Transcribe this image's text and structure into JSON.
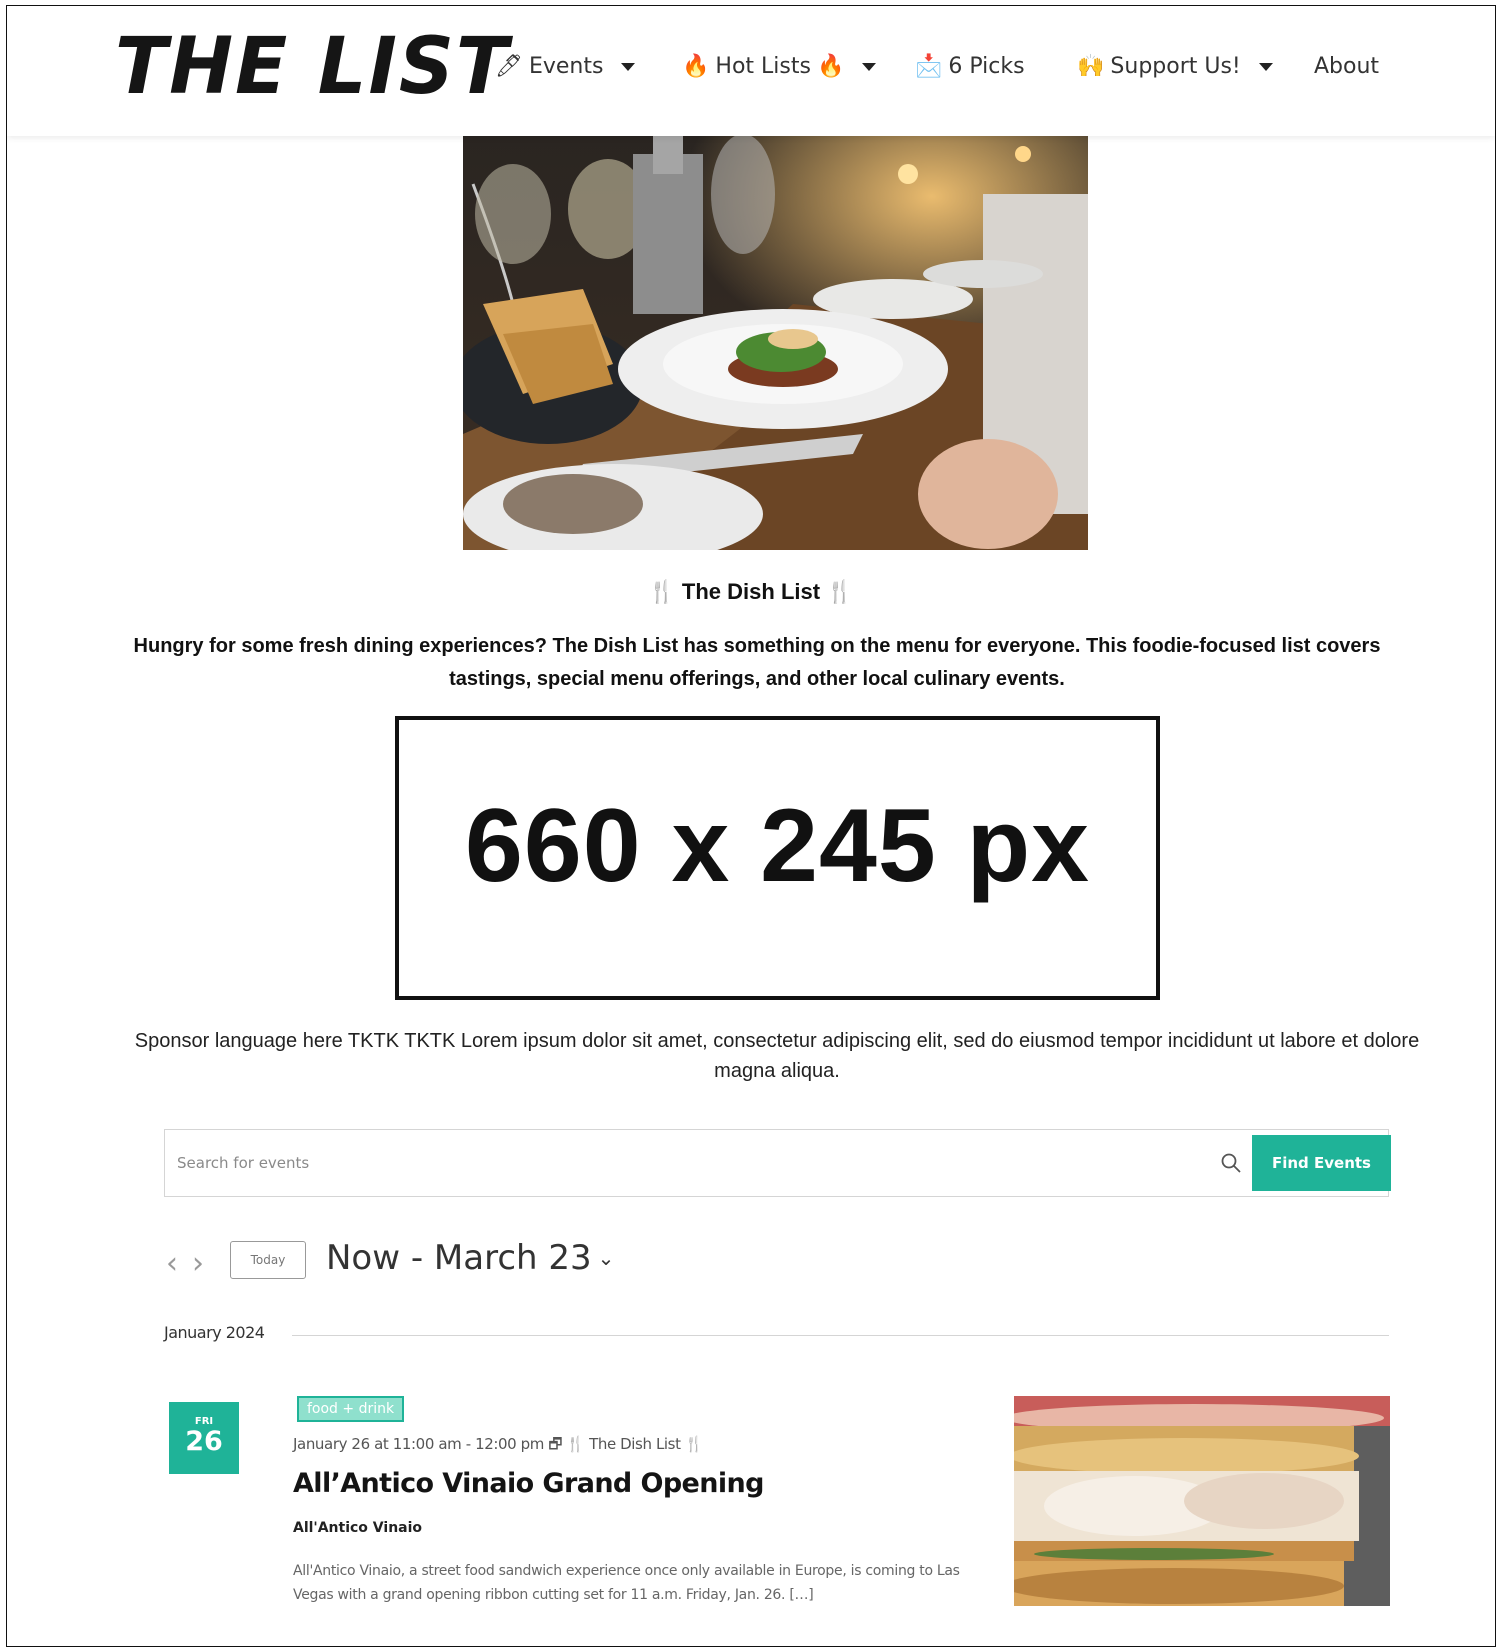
{
  "header": {
    "logo": "THE LIST",
    "nav": [
      {
        "icon": "🖊",
        "label": "Events",
        "dropdown": true
      },
      {
        "icon": "🔥",
        "label": "Hot Lists",
        "suffix_icon": "🔥",
        "dropdown": true
      },
      {
        "icon": "📩",
        "label": "6 Picks",
        "dropdown": false
      },
      {
        "icon": "🙌",
        "label": "Support Us!",
        "dropdown": true
      },
      {
        "icon": "",
        "label": "About",
        "dropdown": false
      }
    ]
  },
  "hero": {
    "title": "🍴 The Dish List 🍴",
    "description": "Hungry for some fresh dining experiences? The Dish List has something on the menu for everyone. This foodie-focused list covers tastings, special menu offerings, and other local culinary events."
  },
  "ad": {
    "label": "660 x 245 px"
  },
  "sponsor_text": "Sponsor language here TKTK TKTK Lorem ipsum dolor sit amet, consectetur adipiscing elit, sed do eiusmod tempor incididunt ut labore et dolore magna aliqua.",
  "search": {
    "placeholder": "Search for events",
    "button_label": "Find Events"
  },
  "date_nav": {
    "prev": "‹",
    "next": "›",
    "today_label": "Today",
    "range_label": "Now - March 23",
    "chevron": "⌄"
  },
  "month_label": "January 2024",
  "event": {
    "dow": "FRI",
    "day": "26",
    "tag": "food + drink",
    "meta": "January 26 at 11:00 am - 12:00 pm 🗗 🍴 The Dish List 🍴",
    "title": "All’Antico Vinaio Grand Opening",
    "venue": "All'Antico Vinaio",
    "description": "All'Antico Vinaio, a street food sandwich experience once only available in Europe, is coming to Las Vegas with a grand opening ribbon cutting set for 11 a.m. Friday, Jan. 26. […]"
  },
  "colors": {
    "accent": "#1fb398",
    "tag_bg": "#8fe0cd"
  }
}
